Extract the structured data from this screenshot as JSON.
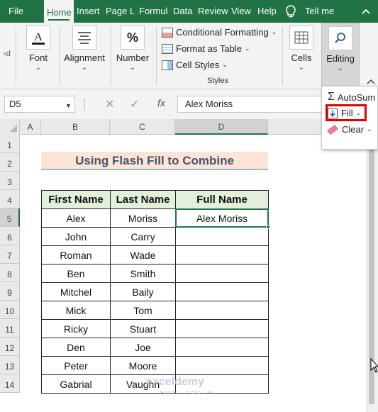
{
  "tabs": [
    {
      "label": "File",
      "active": false
    },
    {
      "label": "Home",
      "active": true
    },
    {
      "label": "Insert",
      "active": false
    },
    {
      "label": "Page La",
      "active": false
    },
    {
      "label": "Formul",
      "active": false
    },
    {
      "label": "Data",
      "active": false
    },
    {
      "label": "Review",
      "active": false
    },
    {
      "label": "View",
      "active": false
    },
    {
      "label": "Help",
      "active": false
    }
  ],
  "tell_me": "Tell me",
  "ribbon": {
    "prev_label": "d",
    "font_label": "Font",
    "alignment_label": "Alignment",
    "number_label": "Number",
    "conditional_formatting": "Conditional Formatting",
    "format_as_table": "Format as Table",
    "cell_styles": "Cell Styles",
    "styles_group": "Styles",
    "cells_label": "Cells",
    "editing_label": "Editing"
  },
  "editing_menu": {
    "autosum": "AutoSum",
    "fill": "Fill",
    "clear": "Clear"
  },
  "formula_bar": {
    "name_box": "D5",
    "formula": "Alex Moriss"
  },
  "columns": [
    "A",
    "B",
    "C",
    "D"
  ],
  "rows": [
    "1",
    "2",
    "3",
    "4",
    "5",
    "6",
    "7",
    "8",
    "9",
    "10",
    "11",
    "12",
    "13",
    "14"
  ],
  "sheet": {
    "title": "Using Flash Fill to Combine",
    "headers": [
      "First Name",
      "Last Name",
      "Full Name"
    ],
    "data": [
      [
        "Alex",
        "Moriss",
        "Alex Moriss"
      ],
      [
        "John",
        "Carry",
        ""
      ],
      [
        "Roman",
        "Wade",
        ""
      ],
      [
        "Ben",
        "Smith",
        ""
      ],
      [
        "Mitchel",
        "Baily",
        ""
      ],
      [
        "Mick",
        "Tom",
        ""
      ],
      [
        "Ricky",
        "Stuart",
        ""
      ],
      [
        "Den",
        "Joe",
        ""
      ],
      [
        "Peter",
        "Moore",
        ""
      ],
      [
        "Gabrial",
        "Vaughn",
        ""
      ]
    ]
  },
  "watermark": {
    "name": "exceldemy",
    "tagline": "EXCEL · DATA · BI"
  },
  "colors": {
    "excel_green": "#217346",
    "title_fill": "#fce4d6",
    "header_fill": "#e2efda",
    "highlight": "#e00000"
  }
}
